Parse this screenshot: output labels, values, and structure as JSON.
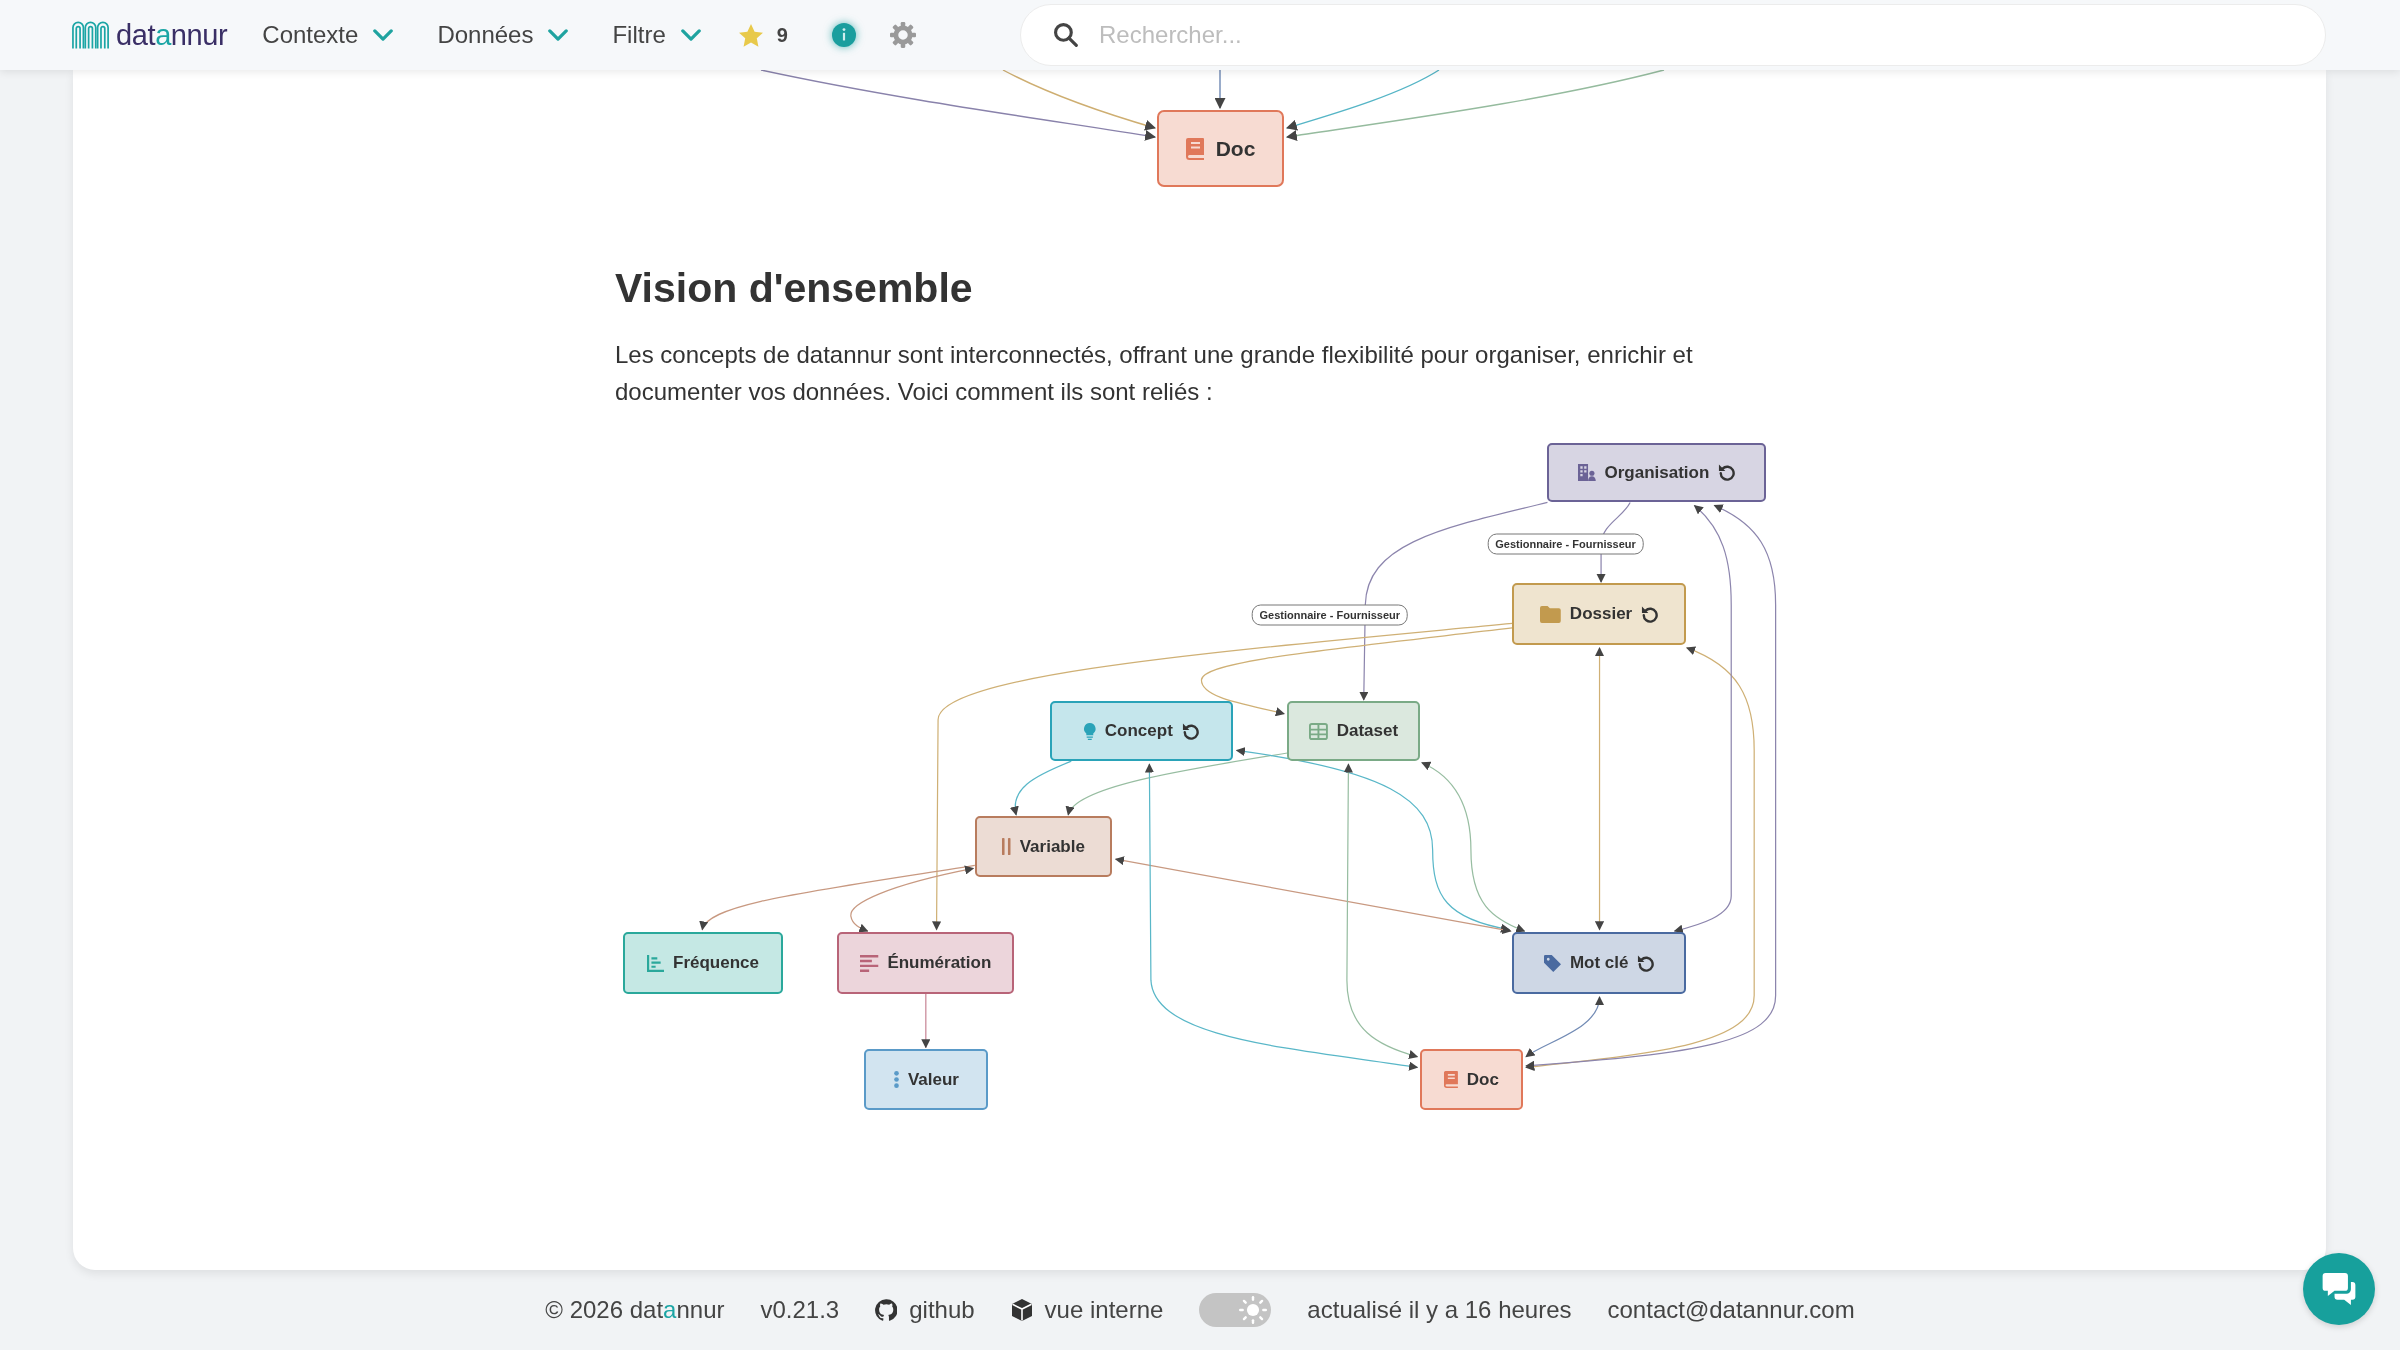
{
  "navbar": {
    "logo": {
      "parts": [
        {
          "text": "dat",
          "accent": false
        },
        {
          "text": "a",
          "accent": true
        },
        {
          "text": "nnur",
          "accent": false
        }
      ]
    },
    "menus": [
      {
        "label": "Contexte"
      },
      {
        "label": "Données"
      },
      {
        "label": "Filtre"
      }
    ],
    "favorites": {
      "count": "9"
    },
    "search": {
      "placeholder": "Rechercher..."
    }
  },
  "previous_diagram": {
    "nodes": [
      {
        "label": "Doc",
        "kind": "doc",
        "color": "#e0785a"
      }
    ]
  },
  "section": {
    "title": "Vision d'ensemble",
    "text": "Les concepts de datannur sont interconnectés, offrant une grande flexibilité pour organiser, enrichir et documenter vos données. Voici comment ils sont reliés :"
  },
  "diagram": {
    "nodes": [
      {
        "label": "Organisation",
        "kind": "organisation",
        "color": "#6b6396",
        "recursive": true
      },
      {
        "label": "Dossier",
        "kind": "dossier",
        "color": "#c29a4e",
        "recursive": true
      },
      {
        "label": "Concept",
        "kind": "concept",
        "color": "#2aa3b8",
        "recursive": true
      },
      {
        "label": "Dataset",
        "kind": "dataset",
        "color": "#7aaa86",
        "recursive": false
      },
      {
        "label": "Variable",
        "kind": "variable",
        "color": "#b87c5e",
        "recursive": false
      },
      {
        "label": "Fréquence",
        "kind": "frequence",
        "color": "#2aa89b",
        "recursive": false
      },
      {
        "label": "Énumération",
        "kind": "enumeration",
        "color": "#b86478",
        "recursive": false
      },
      {
        "label": "Mot clé",
        "kind": "mot_cle",
        "color": "#4a6aa0",
        "recursive": true
      },
      {
        "label": "Valeur",
        "kind": "valeur",
        "color": "#5a9ac8",
        "recursive": false
      },
      {
        "label": "Doc",
        "kind": "doc",
        "color": "#e0785a",
        "recursive": false
      }
    ],
    "edge_labels": [
      "Gestionnaire - Fournisseur",
      "Gestionnaire - Fournisseur"
    ]
  },
  "footer": {
    "copyright": [
      {
        "text": "© 2026 dat",
        "accent": false
      },
      {
        "text": "a",
        "accent": true
      },
      {
        "text": "nnur",
        "accent": false
      }
    ],
    "version": "v0.21.3",
    "links": [
      {
        "label": "github",
        "kind": "github"
      },
      {
        "label": "vue interne",
        "kind": "internal"
      }
    ],
    "theme_toggle": {
      "dark": false
    },
    "updated": "actualisé il y a 16 heures",
    "contact": "contact@datannur.com"
  }
}
